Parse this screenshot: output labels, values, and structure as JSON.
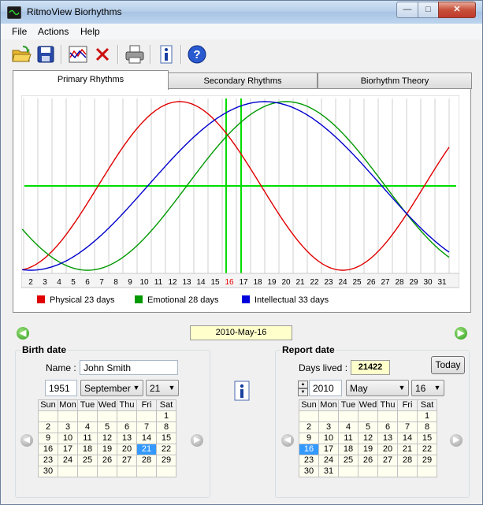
{
  "window": {
    "title": "RitmoView Biorhythms"
  },
  "menu": [
    "File",
    "Actions",
    "Help"
  ],
  "toolbar": {
    "icons": [
      "open-folder-icon",
      "save-icon",
      "chart-icon",
      "delete-icon",
      "print-icon",
      "info-icon",
      "help-icon"
    ]
  },
  "tabs": [
    "Primary Rhythms",
    "Secondary Rhythms",
    "Biorhythm Theory"
  ],
  "chart_data": {
    "type": "line",
    "x": [
      2,
      3,
      4,
      5,
      6,
      7,
      8,
      9,
      10,
      11,
      12,
      13,
      14,
      15,
      16,
      17,
      18,
      19,
      20,
      21,
      22,
      23,
      24,
      25,
      26,
      27,
      28,
      29,
      30,
      31
    ],
    "x_tick_labels": [
      "2",
      "3",
      "4",
      "5",
      "6",
      "7",
      "8",
      "9",
      "10",
      "11",
      "12",
      "13",
      "14",
      "15",
      "16",
      "17",
      "18",
      "19",
      "20",
      "21",
      "22",
      "23",
      "24",
      "25",
      "26",
      "27",
      "28",
      "29",
      "30",
      "31"
    ],
    "highlight_day": "16",
    "ylim": [
      -1,
      1
    ],
    "grid": true,
    "legend": "bottom",
    "series": [
      {
        "name": "Physical 23 days",
        "color": "#e00000",
        "period": 23,
        "peak_day": 12.5
      },
      {
        "name": "Emotional 28 days",
        "color": "#009900",
        "period": 28,
        "peak_day": 20
      },
      {
        "name": "Intellectual 33 days",
        "color": "#0000cc",
        "period": 33,
        "peak_day": 18.5
      }
    ]
  },
  "legend": [
    "Physical 23 days",
    "Emotional 28 days",
    "Intellectual 33 days"
  ],
  "current_date": "2010-May-16",
  "birth": {
    "title": "Birth date",
    "name_label": "Name :",
    "name_value": "John Smith",
    "year": "1951",
    "month": "September",
    "day": "21",
    "calendar": {
      "headers": [
        "Sun",
        "Mon",
        "Tue",
        "Wed",
        "Thu",
        "Fri",
        "Sat"
      ],
      "weeks": [
        [
          "",
          "",
          "",
          "",
          "",
          "",
          "1"
        ],
        [
          "2",
          "3",
          "4",
          "5",
          "6",
          "7",
          "8"
        ],
        [
          "9",
          "10",
          "11",
          "12",
          "13",
          "14",
          "15"
        ],
        [
          "16",
          "17",
          "18",
          "19",
          "20",
          "21",
          "22"
        ],
        [
          "23",
          "24",
          "25",
          "26",
          "27",
          "28",
          "29"
        ],
        [
          "30",
          "",
          "",
          "",
          "",
          "",
          ""
        ]
      ],
      "selected": "21"
    }
  },
  "report": {
    "title": "Report date",
    "days_lived_label": "Days lived :",
    "days_lived_value": "21422",
    "today_label": "Today",
    "year": "2010",
    "month": "May",
    "day": "16",
    "calendar": {
      "headers": [
        "Sun",
        "Mon",
        "Tue",
        "Wed",
        "Thu",
        "Fri",
        "Sat"
      ],
      "weeks": [
        [
          "",
          "",
          "",
          "",
          "",
          "",
          "1"
        ],
        [
          "2",
          "3",
          "4",
          "5",
          "6",
          "7",
          "8"
        ],
        [
          "9",
          "10",
          "11",
          "12",
          "13",
          "14",
          "15"
        ],
        [
          "16",
          "17",
          "18",
          "19",
          "20",
          "21",
          "22"
        ],
        [
          "23",
          "24",
          "25",
          "26",
          "27",
          "28",
          "29"
        ],
        [
          "30",
          "31",
          "",
          "",
          "",
          "",
          ""
        ]
      ],
      "selected": "16"
    }
  }
}
